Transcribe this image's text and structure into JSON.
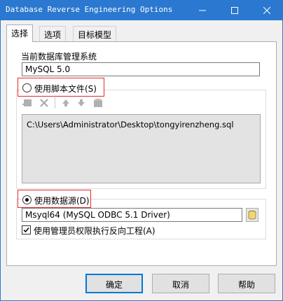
{
  "window": {
    "title": "Database Reverse Engineering Options",
    "controls": {
      "minimize_icon": "minimize-icon",
      "maximize_icon": "maximize-icon",
      "close_icon": "close-icon"
    }
  },
  "tabs": [
    {
      "label": "选择",
      "active": true
    },
    {
      "label": "选项",
      "active": false
    },
    {
      "label": "目标模型",
      "active": false
    }
  ],
  "dbms": {
    "label": "当前数据库管理系统",
    "value": "MySQL 5.0"
  },
  "script_option": {
    "label": "使用脚本文件(S)",
    "selected": false,
    "toolbar_icons": [
      "add-file-icon",
      "delete-icon",
      "move-up-icon",
      "move-down-icon",
      "browse-folder-icon"
    ],
    "files": [
      "C:\\Users\\Administrator\\Desktop\\tongyirenzheng.sql"
    ]
  },
  "datasource_option": {
    "label": "使用数据源(D)",
    "selected": true,
    "value": "Msyql64 (MySQL ODBC 5.1 Driver)",
    "browse_icon": "datasource-connect-icon"
  },
  "admin_option": {
    "label": "使用管理员权限执行反向工程(A)",
    "checked": true
  },
  "buttons": {
    "ok": "确定",
    "cancel": "取消",
    "help": "帮助"
  },
  "colors": {
    "titlebar": "#2b78d0",
    "highlight_box": "#e32a2a",
    "default_button_border": "#0078d7",
    "disabled_list_bg": "#e3e3e3"
  }
}
